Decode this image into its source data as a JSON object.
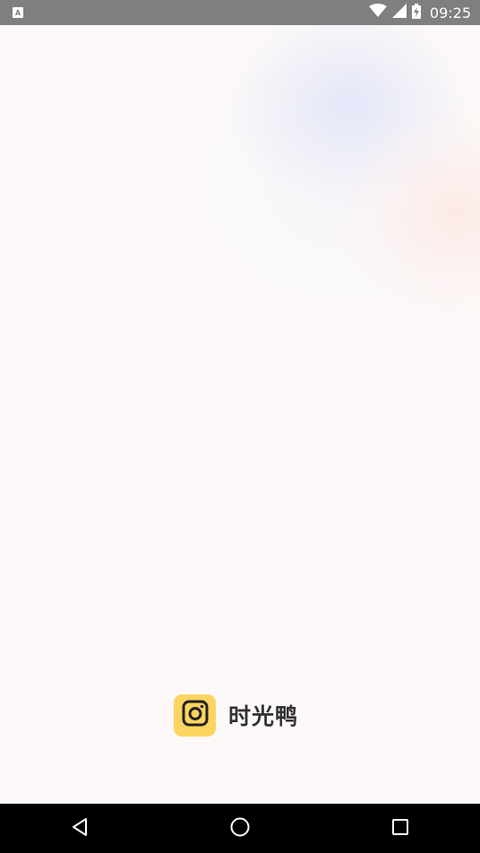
{
  "status_bar": {
    "notification_icon_letter": "A",
    "time": "09:25",
    "icons": [
      "notification-icon",
      "wifi-icon",
      "signal-icon",
      "battery-charging-icon"
    ]
  },
  "splash": {
    "logo_icon": "camera-icon",
    "app_name": "时光鸭",
    "colors": {
      "logo_background": "#fcd460",
      "background": "#fdf9f8",
      "text": "#333333"
    }
  },
  "nav_bar": {
    "buttons": [
      "back-icon",
      "home-icon",
      "recents-icon"
    ]
  }
}
